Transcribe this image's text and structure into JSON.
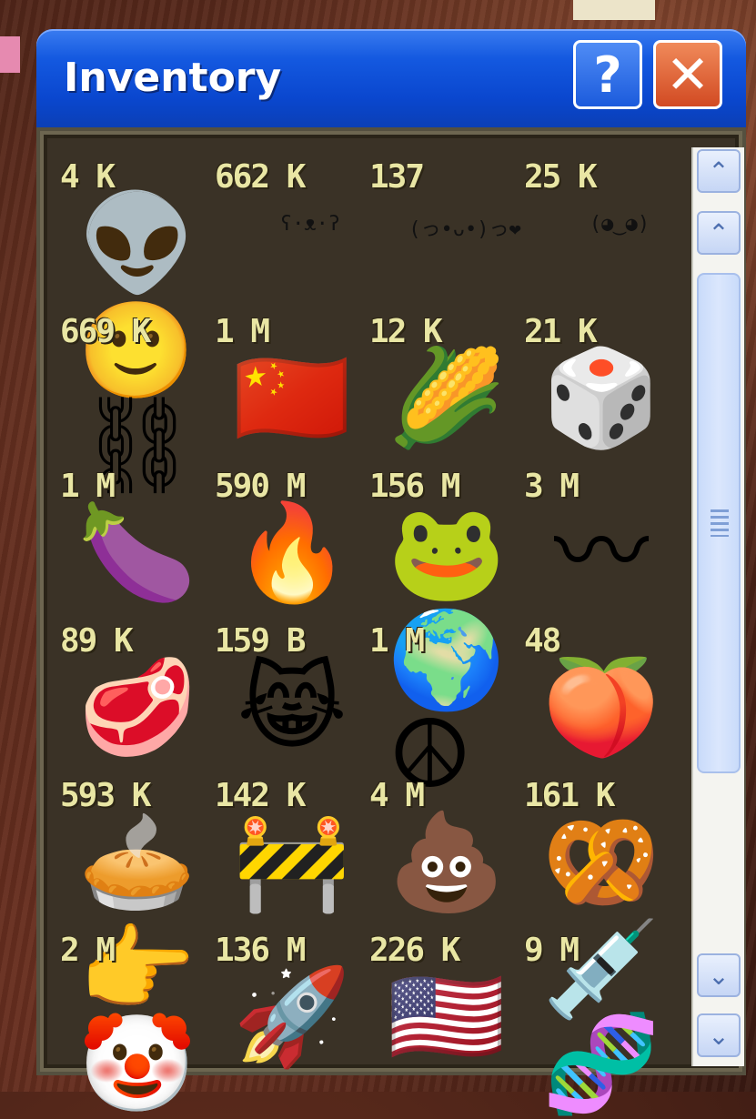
{
  "window": {
    "title": "Inventory",
    "help_label": "?",
    "close_label": "✕",
    "accent_color": "#1459e0"
  },
  "scrollbar": {
    "up_label": "⌃",
    "down_label": "⌄"
  },
  "inventory": {
    "items": [
      {
        "qty": "4 K",
        "icon": "alien-icon",
        "glyph": "👽"
      },
      {
        "qty": "662 K",
        "icon": "kaomoji-bear-icon",
        "glyph": "ʕ·ᴥ·ʔ"
      },
      {
        "qty": "137",
        "icon": "kaomoji-heart-icon",
        "glyph": "(っ•ᴗ•)っ❤"
      },
      {
        "qty": "25 K",
        "icon": "kaomoji-eyes-icon",
        "glyph": "(◕‿◕)"
      },
      {
        "qty": "669 K",
        "icon": "smile-chain-icon",
        "glyph": "🙂⛓"
      },
      {
        "qty": "1 M",
        "icon": "china-flag-icon",
        "glyph": "🇨🇳"
      },
      {
        "qty": "12 K",
        "icon": "corn-icon",
        "glyph": "🌽"
      },
      {
        "qty": "21 K",
        "icon": "dice-icon",
        "glyph": "🎲"
      },
      {
        "qty": "1 M",
        "icon": "eggplant-icon",
        "glyph": "🍆"
      },
      {
        "qty": "590 M",
        "icon": "fire-icon",
        "glyph": "🔥"
      },
      {
        "qty": "156 M",
        "icon": "frog-icon",
        "glyph": "🐸"
      },
      {
        "qty": "3 M",
        "icon": "whip-icon",
        "glyph": "〰"
      },
      {
        "qty": "89 K",
        "icon": "meat-icon",
        "glyph": "🥩"
      },
      {
        "qty": "159 B",
        "icon": "cat-tears-of-joy-icon",
        "glyph": "😹"
      },
      {
        "qty": "1 M",
        "icon": "globe-peace-icon",
        "glyph": "🌍☮"
      },
      {
        "qty": "48",
        "icon": "peach-icon",
        "glyph": "🍑"
      },
      {
        "qty": "593 K",
        "icon": "pie-icon",
        "glyph": "🥧"
      },
      {
        "qty": "142 K",
        "icon": "under-construction-sign-icon",
        "glyph": "🚧"
      },
      {
        "qty": "4 M",
        "icon": "poop-icon",
        "glyph": "💩"
      },
      {
        "qty": "161 K",
        "icon": "pretzel-icon",
        "glyph": "🥨"
      },
      {
        "qty": "2 M",
        "icon": "pointing-clown-icon",
        "glyph": "👉🤡"
      },
      {
        "qty": "136 M",
        "icon": "rocket-icon",
        "glyph": "🚀"
      },
      {
        "qty": "226 K",
        "icon": "usa-flag-icon",
        "glyph": "🇺🇸"
      },
      {
        "qty": "9 M",
        "icon": "syringe-dna-icon",
        "glyph": "💉🧬"
      }
    ]
  }
}
